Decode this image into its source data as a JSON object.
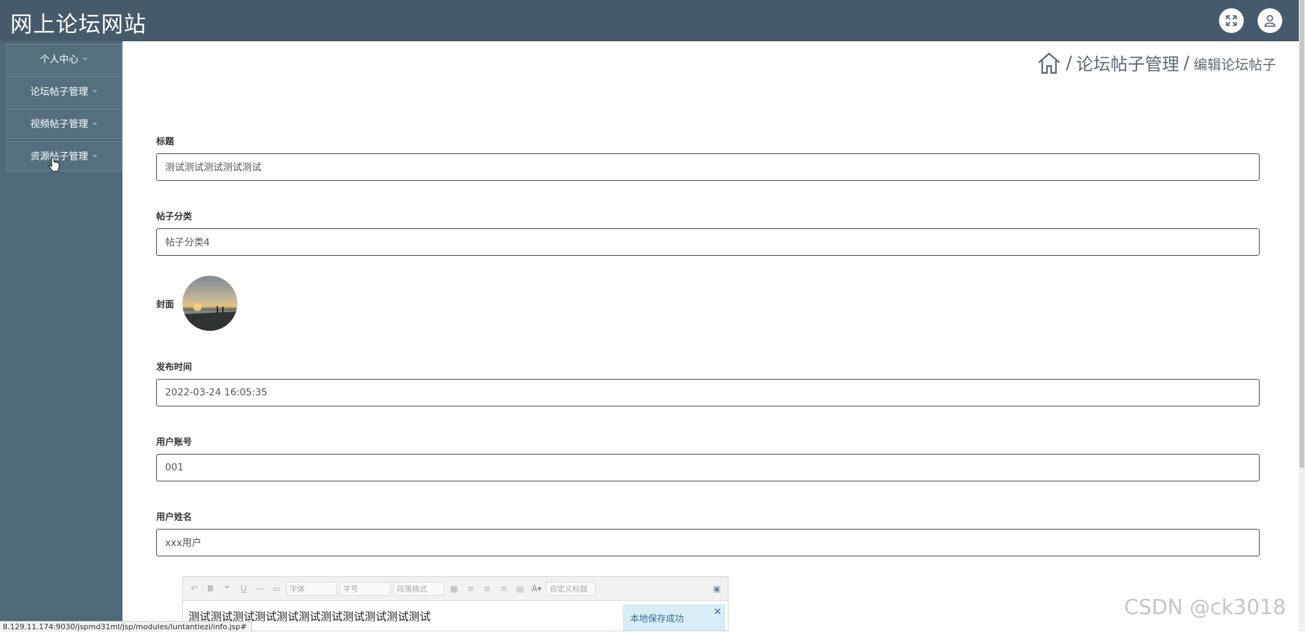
{
  "header": {
    "title": "网上论坛网站"
  },
  "sidebar": {
    "items": [
      {
        "label": "个人中心"
      },
      {
        "label": "论坛帖子管理"
      },
      {
        "label": "视频帖子管理"
      },
      {
        "label": "资源帖子管理"
      }
    ]
  },
  "breadcrumb": {
    "sep": "/",
    "section": "论坛帖子管理",
    "current": "编辑论坛帖子"
  },
  "form": {
    "title": {
      "label": "标题",
      "value": "测试测试测试测试测试"
    },
    "category": {
      "label": "帖子分类",
      "value": "帖子分类4"
    },
    "cover": {
      "label": "封面"
    },
    "publish_time": {
      "label": "发布时间",
      "value": "2022-03-24 16:05:35"
    },
    "user_account": {
      "label": "用户账号",
      "value": "001"
    },
    "user_name": {
      "label": "用户姓名",
      "value": "xxx用户"
    }
  },
  "editor": {
    "toolbar": {
      "font_family": "字体",
      "font_size": "字号",
      "paragraph": "段落格式",
      "custom_title": "自定义标题"
    },
    "content": "测试测试测试测试测试测试测试测试测试测试测试",
    "toast": "本地保存成功"
  },
  "status_url": "8.129.11.174:9030/jspmd31ml/jsp/modules/luntantiezi/info.jsp#",
  "watermark": "CSDN @ck3018"
}
